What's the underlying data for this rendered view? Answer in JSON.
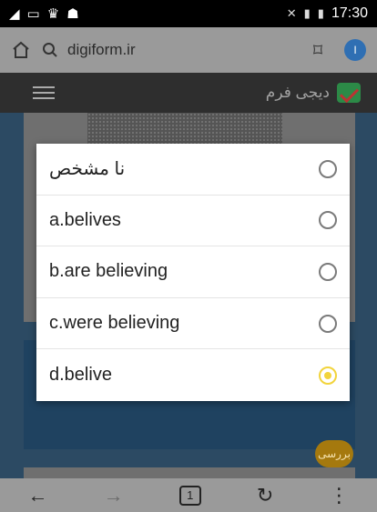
{
  "status_bar": {
    "time": "17:30"
  },
  "browser": {
    "url": "digiform.ir",
    "profile_initial": "I"
  },
  "site": {
    "brand": "دیجی فرم"
  },
  "background": {
    "badge_text": "بررسی"
  },
  "options": [
    {
      "label": "نا مشخص",
      "checked": false,
      "rtl": true
    },
    {
      "label": "a.belives",
      "checked": false,
      "rtl": false
    },
    {
      "label": "b.are believing",
      "checked": false,
      "rtl": false
    },
    {
      "label": "c.were believing",
      "checked": false,
      "rtl": false
    },
    {
      "label": "d.belive",
      "checked": true,
      "rtl": false
    }
  ],
  "bottom_nav": {
    "tabs_count": "1"
  },
  "colors": {
    "accent_radio": "#f2d43c",
    "header_bg": "#2e2e2e",
    "page_bg": "#2c4a63"
  }
}
